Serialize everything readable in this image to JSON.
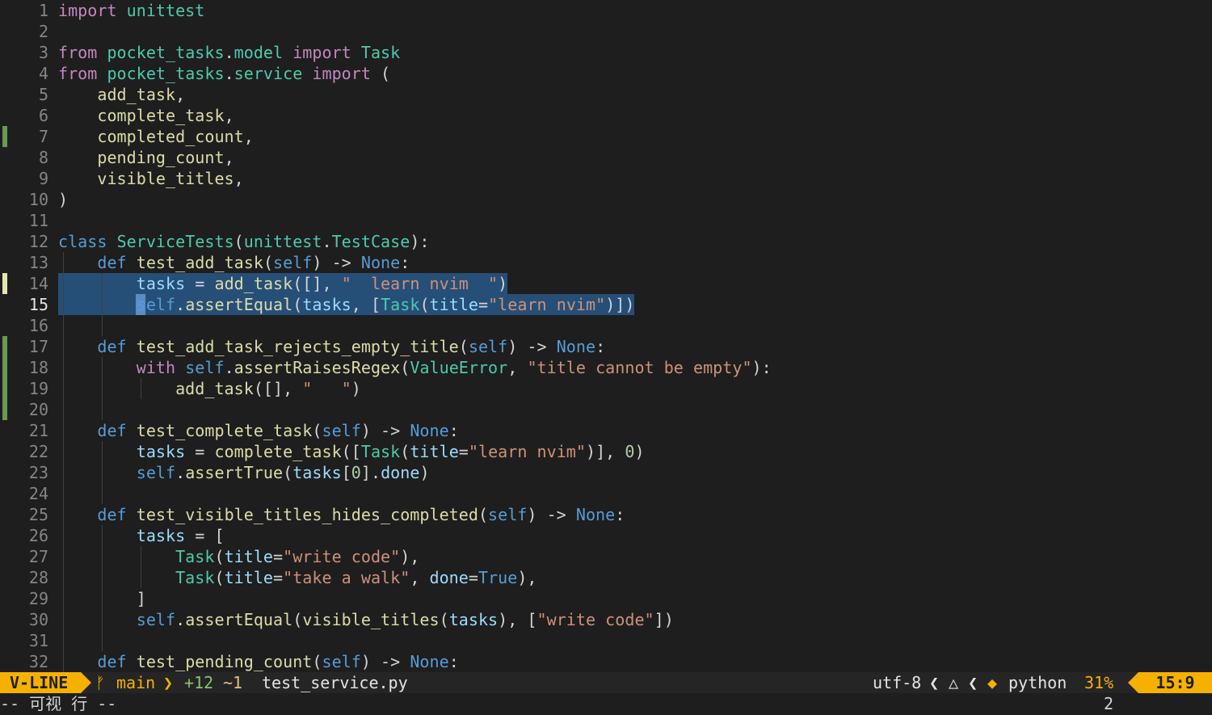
{
  "editor": {
    "lines": [
      {
        "n": "1",
        "sign": "",
        "segs": [
          [
            "k",
            "import"
          ],
          [
            "t",
            " "
          ],
          [
            "m",
            "unittest"
          ]
        ]
      },
      {
        "n": "2",
        "sign": "",
        "segs": []
      },
      {
        "n": "3",
        "sign": "",
        "segs": [
          [
            "k",
            "from"
          ],
          [
            "t",
            " "
          ],
          [
            "m",
            "pocket_tasks"
          ],
          [
            "t",
            "."
          ],
          [
            "m",
            "model"
          ],
          [
            "t",
            " "
          ],
          [
            "k",
            "import"
          ],
          [
            "t",
            " "
          ],
          [
            "c",
            "Task"
          ]
        ]
      },
      {
        "n": "4",
        "sign": "",
        "segs": [
          [
            "k",
            "from"
          ],
          [
            "t",
            " "
          ],
          [
            "m",
            "pocket_tasks"
          ],
          [
            "t",
            "."
          ],
          [
            "m",
            "service"
          ],
          [
            "t",
            " "
          ],
          [
            "k",
            "import"
          ],
          [
            "t",
            " ("
          ]
        ]
      },
      {
        "n": "5",
        "sign": "",
        "segs": [
          [
            "t",
            "    "
          ],
          [
            "f",
            "add_task"
          ],
          [
            "t",
            ","
          ]
        ]
      },
      {
        "n": "6",
        "sign": "",
        "segs": [
          [
            "t",
            "    "
          ],
          [
            "f",
            "complete_task"
          ],
          [
            "t",
            ","
          ]
        ]
      },
      {
        "n": "7",
        "sign": "added",
        "segs": [
          [
            "t",
            "    "
          ],
          [
            "f",
            "completed_count"
          ],
          [
            "t",
            ","
          ]
        ]
      },
      {
        "n": "8",
        "sign": "",
        "segs": [
          [
            "t",
            "    "
          ],
          [
            "f",
            "pending_count"
          ],
          [
            "t",
            ","
          ]
        ]
      },
      {
        "n": "9",
        "sign": "",
        "segs": [
          [
            "t",
            "    "
          ],
          [
            "f",
            "visible_titles"
          ],
          [
            "t",
            ","
          ]
        ]
      },
      {
        "n": "10",
        "sign": "",
        "segs": [
          [
            "t",
            ")"
          ]
        ]
      },
      {
        "n": "11",
        "sign": "",
        "segs": []
      },
      {
        "n": "12",
        "sign": "",
        "segs": [
          [
            "d",
            "class"
          ],
          [
            "t",
            " "
          ],
          [
            "c",
            "ServiceTests"
          ],
          [
            "t",
            "("
          ],
          [
            "m",
            "unittest"
          ],
          [
            "t",
            "."
          ],
          [
            "c",
            "TestCase"
          ],
          [
            "t",
            "):"
          ]
        ]
      },
      {
        "n": "13",
        "sign": "",
        "segs": [
          [
            "t",
            "    "
          ],
          [
            "d",
            "def"
          ],
          [
            "t",
            " "
          ],
          [
            "f",
            "test_add_task"
          ],
          [
            "t",
            "("
          ],
          [
            "slf",
            "self"
          ],
          [
            "t",
            ") -> "
          ],
          [
            "d",
            "None"
          ],
          [
            "t",
            ":"
          ]
        ]
      },
      {
        "n": "14",
        "sign": "changed",
        "segs": [
          [
            "t",
            "        "
          ],
          [
            "v",
            "tasks"
          ],
          [
            "t",
            " = "
          ],
          [
            "f",
            "add_task"
          ],
          [
            "t",
            "([], "
          ],
          [
            "s",
            "\"  learn nvim  \""
          ],
          [
            "t",
            ")"
          ]
        ]
      },
      {
        "n": "15",
        "sign": "",
        "cur": true,
        "segs": [
          [
            "t",
            "        "
          ],
          [
            "slf",
            "self"
          ],
          [
            "t",
            "."
          ],
          [
            "f",
            "assertEqual"
          ],
          [
            "t",
            "("
          ],
          [
            "v",
            "tasks"
          ],
          [
            "t",
            ", ["
          ],
          [
            "c",
            "Task"
          ],
          [
            "t",
            "("
          ],
          [
            "kw",
            "title"
          ],
          [
            "t",
            "="
          ],
          [
            "s",
            "\"learn nvim\""
          ],
          [
            "t",
            ")])"
          ]
        ]
      },
      {
        "n": "16",
        "sign": "",
        "segs": []
      },
      {
        "n": "17",
        "sign": "added",
        "segs": [
          [
            "t",
            "    "
          ],
          [
            "d",
            "def"
          ],
          [
            "t",
            " "
          ],
          [
            "f",
            "test_add_task_rejects_empty_title"
          ],
          [
            "t",
            "("
          ],
          [
            "slf",
            "self"
          ],
          [
            "t",
            ") -> "
          ],
          [
            "d",
            "None"
          ],
          [
            "t",
            ":"
          ]
        ]
      },
      {
        "n": "18",
        "sign": "added",
        "segs": [
          [
            "t",
            "        "
          ],
          [
            "k",
            "with"
          ],
          [
            "t",
            " "
          ],
          [
            "slf",
            "self"
          ],
          [
            "t",
            "."
          ],
          [
            "f",
            "assertRaisesRegex"
          ],
          [
            "t",
            "("
          ],
          [
            "c",
            "ValueError"
          ],
          [
            "t",
            ", "
          ],
          [
            "s",
            "\"title cannot be empty\""
          ],
          [
            "t",
            "):"
          ]
        ]
      },
      {
        "n": "19",
        "sign": "added",
        "segs": [
          [
            "t",
            "            "
          ],
          [
            "f",
            "add_task"
          ],
          [
            "t",
            "([], "
          ],
          [
            "s",
            "\"   \""
          ],
          [
            "t",
            ")"
          ]
        ]
      },
      {
        "n": "20",
        "sign": "added",
        "segs": []
      },
      {
        "n": "21",
        "sign": "",
        "segs": [
          [
            "t",
            "    "
          ],
          [
            "d",
            "def"
          ],
          [
            "t",
            " "
          ],
          [
            "f",
            "test_complete_task"
          ],
          [
            "t",
            "("
          ],
          [
            "slf",
            "self"
          ],
          [
            "t",
            ") -> "
          ],
          [
            "d",
            "None"
          ],
          [
            "t",
            ":"
          ]
        ]
      },
      {
        "n": "22",
        "sign": "",
        "segs": [
          [
            "t",
            "        "
          ],
          [
            "v",
            "tasks"
          ],
          [
            "t",
            " = "
          ],
          [
            "f",
            "complete_task"
          ],
          [
            "t",
            "(["
          ],
          [
            "c",
            "Task"
          ],
          [
            "t",
            "("
          ],
          [
            "kw",
            "title"
          ],
          [
            "t",
            "="
          ],
          [
            "s",
            "\"learn nvim\""
          ],
          [
            "t",
            ")], "
          ],
          [
            "n",
            "0"
          ],
          [
            "t",
            ")"
          ]
        ]
      },
      {
        "n": "23",
        "sign": "",
        "segs": [
          [
            "t",
            "        "
          ],
          [
            "slf",
            "self"
          ],
          [
            "t",
            "."
          ],
          [
            "f",
            "assertTrue"
          ],
          [
            "t",
            "("
          ],
          [
            "v",
            "tasks"
          ],
          [
            "t",
            "["
          ],
          [
            "n",
            "0"
          ],
          [
            "t",
            "]."
          ],
          [
            "v",
            "done"
          ],
          [
            "t",
            ")"
          ]
        ]
      },
      {
        "n": "24",
        "sign": "",
        "segs": []
      },
      {
        "n": "25",
        "sign": "",
        "segs": [
          [
            "t",
            "    "
          ],
          [
            "d",
            "def"
          ],
          [
            "t",
            " "
          ],
          [
            "f",
            "test_visible_titles_hides_completed"
          ],
          [
            "t",
            "("
          ],
          [
            "slf",
            "self"
          ],
          [
            "t",
            ") -> "
          ],
          [
            "d",
            "None"
          ],
          [
            "t",
            ":"
          ]
        ]
      },
      {
        "n": "26",
        "sign": "",
        "segs": [
          [
            "t",
            "        "
          ],
          [
            "v",
            "tasks"
          ],
          [
            "t",
            " = ["
          ]
        ]
      },
      {
        "n": "27",
        "sign": "",
        "segs": [
          [
            "t",
            "            "
          ],
          [
            "c",
            "Task"
          ],
          [
            "t",
            "("
          ],
          [
            "kw",
            "title"
          ],
          [
            "t",
            "="
          ],
          [
            "s",
            "\"write code\""
          ],
          [
            "t",
            "),"
          ]
        ]
      },
      {
        "n": "28",
        "sign": "",
        "segs": [
          [
            "t",
            "            "
          ],
          [
            "c",
            "Task"
          ],
          [
            "t",
            "("
          ],
          [
            "kw",
            "title"
          ],
          [
            "t",
            "="
          ],
          [
            "s",
            "\"take a walk\""
          ],
          [
            "t",
            ", "
          ],
          [
            "kw",
            "done"
          ],
          [
            "t",
            "="
          ],
          [
            "d",
            "True"
          ],
          [
            "t",
            "),"
          ]
        ]
      },
      {
        "n": "29",
        "sign": "",
        "segs": [
          [
            "t",
            "        ]"
          ]
        ]
      },
      {
        "n": "30",
        "sign": "",
        "segs": [
          [
            "t",
            "        "
          ],
          [
            "slf",
            "self"
          ],
          [
            "t",
            "."
          ],
          [
            "f",
            "assertEqual"
          ],
          [
            "t",
            "("
          ],
          [
            "f",
            "visible_titles"
          ],
          [
            "t",
            "("
          ],
          [
            "v",
            "tasks"
          ],
          [
            "t",
            "), ["
          ],
          [
            "s",
            "\"write code\""
          ],
          [
            "t",
            "])"
          ]
        ]
      },
      {
        "n": "31",
        "sign": "",
        "segs": []
      },
      {
        "n": "32",
        "sign": "",
        "segs": [
          [
            "t",
            "    "
          ],
          [
            "d",
            "def"
          ],
          [
            "t",
            " "
          ],
          [
            "f",
            "test_pending_count"
          ],
          [
            "t",
            "("
          ],
          [
            "slf",
            "self"
          ],
          [
            "t",
            ") -> "
          ],
          [
            "d",
            "None"
          ],
          [
            "t",
            ":"
          ]
        ]
      }
    ]
  },
  "colors": {
    "added": "#6a9955",
    "changed": "#e5e5b0",
    "accent": "#f6b100",
    "selection": "#264f78"
  },
  "statusline": {
    "mode": "V-LINE",
    "branch_icon": "ᚠ",
    "branch": "main",
    "separator": "❯",
    "added": "+12",
    "changed": "~1",
    "filename": "test_service.py",
    "encoding": "utf-8",
    "sep_left": "❮",
    "os_icon": "linux-icon",
    "os_glyph": "△",
    "filetype_icon": "python-icon",
    "filetype_glyph": "◆",
    "filetype": "python",
    "percent": "31%",
    "position": "15:9"
  },
  "cmdline": {
    "message": "-- 可视 行 --",
    "count": "2"
  }
}
